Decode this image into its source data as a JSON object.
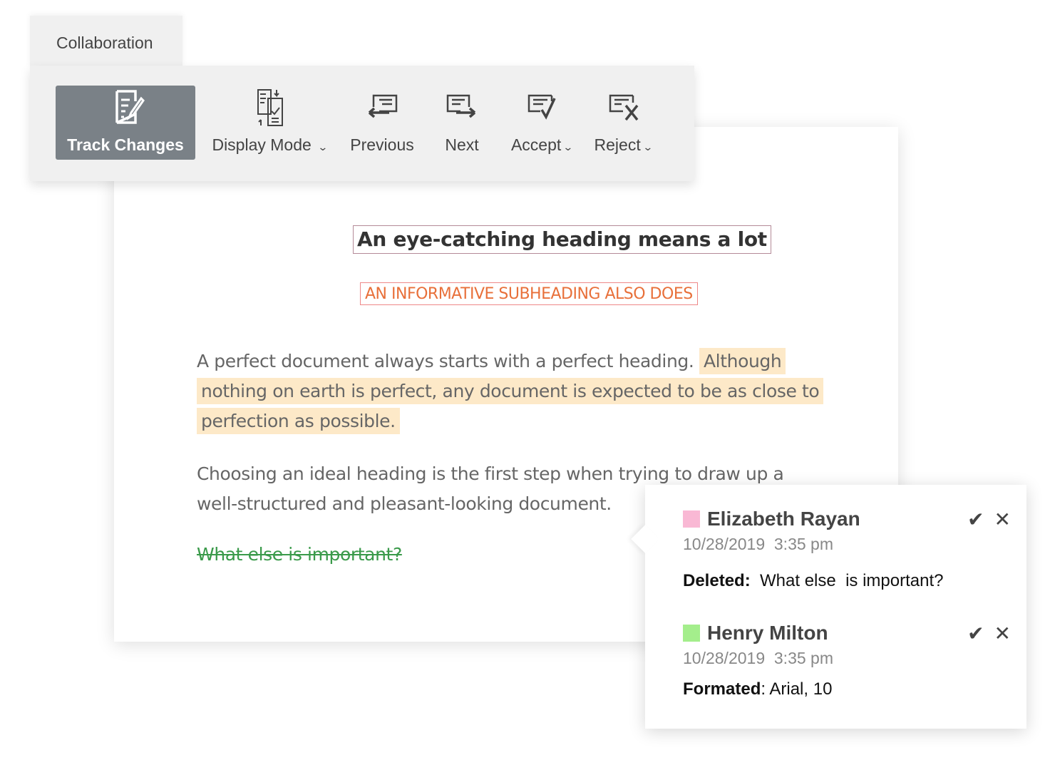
{
  "ribbon": {
    "tab_label": "Collaboration",
    "tools": [
      {
        "label": "Track Changes",
        "icon": "track-changes-icon",
        "active": true
      },
      {
        "label": "Display Mode",
        "icon": "display-mode-icon",
        "dropdown": true
      },
      {
        "label": "Previous",
        "icon": "previous-change-icon"
      },
      {
        "label": "Next",
        "icon": "next-change-icon"
      },
      {
        "label": "Accept",
        "icon": "accept-icon",
        "dropdown": true
      },
      {
        "label": "Reject",
        "icon": "reject-icon",
        "dropdown": true
      }
    ]
  },
  "document": {
    "heading": "An eye-catching heading means a lot",
    "subheading": "AN INFORMATIVE SUBHEADING ALSO DOES",
    "paragraph1_plain": "A perfect document always starts with a perfect heading. ",
    "paragraph1_highlighted": "Although nothing on earth is perfect, any document is expected to be as close to perfection as possible.",
    "paragraph2": "Choosing an ideal heading is the first step when trying to draw up a well-structured and pleasant-looking document.",
    "deleted_text": "What else  is important?"
  },
  "changes": [
    {
      "author": "Elizabeth Rayan",
      "color": "#f9b8d4",
      "date": "10/28/2019  3:35 pm",
      "type_label": "Deleted:",
      "detail": "  What else  is important?"
    },
    {
      "author": "Henry Milton",
      "color": "#a4ee8c",
      "date": "10/28/2019  3:35 pm",
      "type_label": "Formated",
      "detail": ": Arial, 10"
    }
  ],
  "colors": {
    "highlight": "#fde9c8",
    "subheading": "#e8703a",
    "deleted": "#3a9a4a",
    "active_tool": "#7a8187"
  }
}
